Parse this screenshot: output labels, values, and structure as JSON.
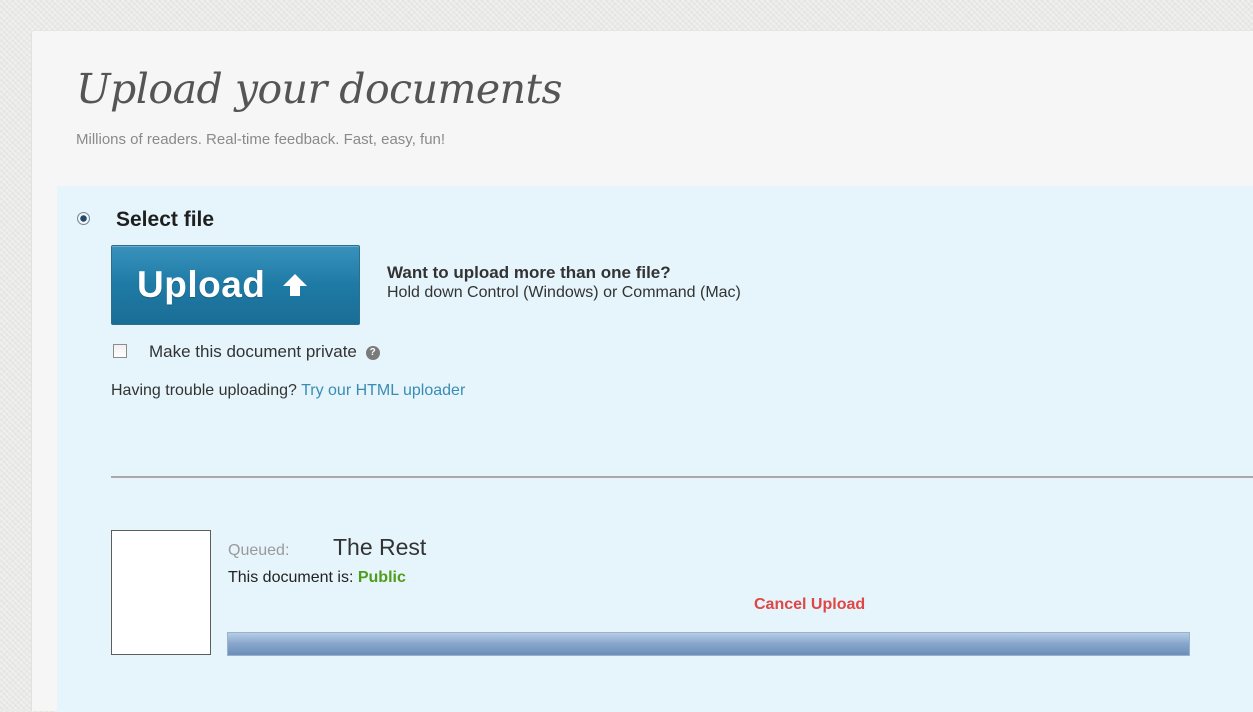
{
  "header": {
    "title": "Upload your documents",
    "subtitle": "Millions of readers. Real-time feedback. Fast, easy, fun!"
  },
  "select_file": {
    "label": "Select file",
    "selected": true,
    "upload_button_label": "Upload",
    "upload_button_icon": "arrow-up-icon",
    "multi_title": "Want to upload more than one file?",
    "multi_desc": "Hold down Control (Windows) or Command (Mac)",
    "private_label": "Make this document private",
    "private_checked": false,
    "help_icon": "question-mark-icon",
    "help_glyph": "?",
    "trouble_text": "Having trouble uploading?",
    "trouble_link": "Try our HTML uploader"
  },
  "queue_item": {
    "status_label": "Queued:",
    "document_name": "The Rest",
    "visibility_prefix": "This document is:",
    "visibility_value": "Public",
    "cancel_label": "Cancel Upload",
    "progress_percent": 100
  },
  "colors": {
    "panel_background": "#e5f5fb",
    "upload_button": "#1e7aa5",
    "link": "#3a8cb5",
    "public": "#4f9d1b",
    "cancel": "#e04646",
    "progress_fill": "#86a5cb"
  }
}
